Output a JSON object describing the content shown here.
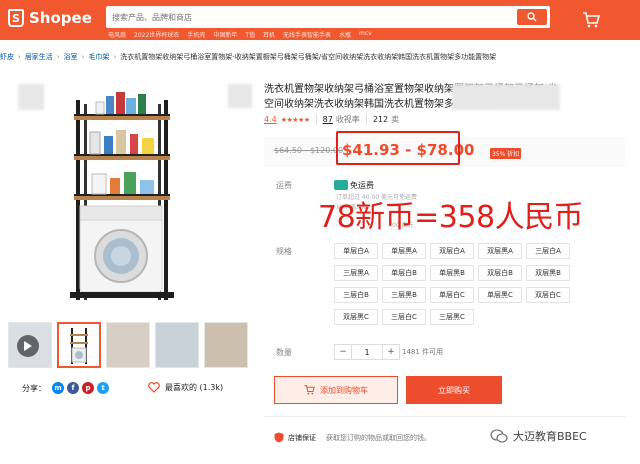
{
  "header": {
    "logo_text": "Shopee",
    "search_placeholder": "搜索产品、品牌和商店",
    "hotwords": [
      "电风扇",
      "2022世界杯球衣",
      "手机壳",
      "中国新年",
      "T恤",
      "耳机",
      "无线手表智能手表",
      "水瓶",
      "mcv"
    ]
  },
  "breadcrumb": {
    "items": [
      "虾皮",
      "居家生活",
      "浴室",
      "毛巾架"
    ],
    "current": "洗衣机置物架收纳架弓桶浴室置物架-收纳架置橱架弓桶架弓桶架/省空间收纳架洗衣收纳架韩国洗衣机置物架多功能置物架"
  },
  "product": {
    "title": "洗衣机置物架收纳架弓桶浴室置物架收纳架置橱架弓桶架弓桶架/省空间收纳架洗衣收纳架韩国洗衣机置物架多功能置物架",
    "rating_value": "4.4",
    "rating_stars": "★★★★★",
    "review_count": "87",
    "review_label": "收视率",
    "sold_count": "212",
    "sold_label": "卖",
    "original_price": "$64.50 - $120.00",
    "current_price": "$41.93 - $78.00",
    "discount_badge": "35% 折扣",
    "annotation": "78新币=358人民币"
  },
  "shipping": {
    "row_label": "运费",
    "label": "免运费",
    "sub_lines": [
      "订单超过 40.00 美元可免运费",
      "从 中国大陆",
      "00 美元"
    ]
  },
  "variants": {
    "row_label": "规格",
    "options": [
      "单层白A",
      "单层黑A",
      "双层白A",
      "双层黑A",
      "三层白A",
      "三层黑A",
      "单层白B",
      "单层黑B",
      "双层白B",
      "双层黑B",
      "三层白B",
      "三层黑B",
      "单层白C",
      "单层黑C",
      "双层白C",
      "双层黑C",
      "三层白C",
      "三层黑C"
    ]
  },
  "quantity": {
    "row_label": "数量",
    "minus": "−",
    "value": "1",
    "plus": "+",
    "available": "1481 件可用"
  },
  "actions": {
    "add_to_cart": "添加到购物车",
    "buy_now": "立即购买"
  },
  "guarantee": {
    "label": "店铺保证",
    "text": "获取您订购的物品或取回您的钱。"
  },
  "share": {
    "label": "分享："
  },
  "like": {
    "label": "最喜欢的 (1.3k)"
  },
  "watermark": {
    "text": "大迈教育BBEC"
  },
  "colors": {
    "brand": "#f1582f",
    "price": "#ee4d2d",
    "annotation": "#e0201a"
  }
}
